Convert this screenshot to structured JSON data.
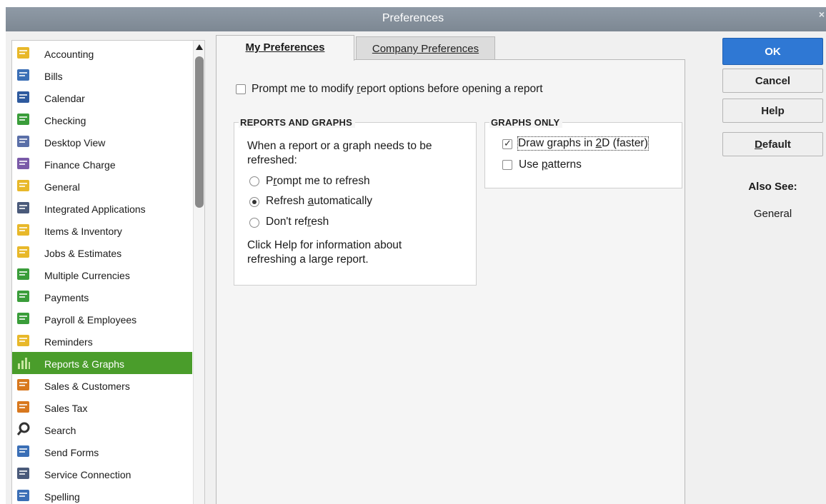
{
  "window": {
    "title": "Preferences",
    "close_glyph": "×"
  },
  "sidebar": {
    "items": [
      {
        "label": "Accounting",
        "icon": "accounting-icon"
      },
      {
        "label": "Bills",
        "icon": "bills-icon"
      },
      {
        "label": "Calendar",
        "icon": "calendar-icon"
      },
      {
        "label": "Checking",
        "icon": "checking-icon"
      },
      {
        "label": "Desktop View",
        "icon": "desktop-view-icon"
      },
      {
        "label": "Finance Charge",
        "icon": "finance-charge-icon"
      },
      {
        "label": "General",
        "icon": "general-icon"
      },
      {
        "label": "Integrated Applications",
        "icon": "integrated-applications-icon"
      },
      {
        "label": "Items & Inventory",
        "icon": "items-inventory-icon"
      },
      {
        "label": "Jobs & Estimates",
        "icon": "jobs-estimates-icon"
      },
      {
        "label": "Multiple Currencies",
        "icon": "multiple-currencies-icon"
      },
      {
        "label": "Payments",
        "icon": "payments-icon"
      },
      {
        "label": "Payroll & Employees",
        "icon": "payroll-employees-icon"
      },
      {
        "label": "Reminders",
        "icon": "reminders-icon"
      },
      {
        "label": "Reports & Graphs",
        "icon": "reports-graphs-icon",
        "selected": true
      },
      {
        "label": "Sales & Customers",
        "icon": "sales-customers-icon"
      },
      {
        "label": "Sales Tax",
        "icon": "sales-tax-icon"
      },
      {
        "label": "Search",
        "icon": "search-icon"
      },
      {
        "label": "Send Forms",
        "icon": "send-forms-icon"
      },
      {
        "label": "Service Connection",
        "icon": "service-connection-icon"
      },
      {
        "label": "Spelling",
        "icon": "spelling-icon"
      }
    ]
  },
  "tabs": {
    "my_preferences": "My Preferences",
    "company_preferences": "Company Preferences"
  },
  "prompt_modify": {
    "label_pre": "Prompt me to modify ",
    "label_u": "r",
    "label_post": "eport options before opening a report",
    "checked": false
  },
  "reports_graphs": {
    "title": "REPORTS AND GRAPHS",
    "desc_line1": "When a report or a graph needs to be",
    "desc_line2": "refreshed:",
    "options": {
      "prompt": {
        "pre": "P",
        "u": "r",
        "post": "ompt me to refresh",
        "checked": false
      },
      "auto": {
        "pre": "Refresh ",
        "u": "a",
        "post": "utomatically",
        "checked": true
      },
      "dont": {
        "pre": "Don't ref",
        "u": "r",
        "post": "esh",
        "checked": false
      }
    },
    "help_line1": "Click Help for information about",
    "help_line2": "refreshing a large report."
  },
  "graphs_only": {
    "title": "GRAPHS ONLY",
    "draw_2d": {
      "pre": "Draw graphs in ",
      "u": "2",
      "post": "D (faster)",
      "checked": true
    },
    "patterns": {
      "pre": "Use ",
      "u": "p",
      "post": "atterns",
      "checked": false
    }
  },
  "buttons": {
    "ok": "OK",
    "cancel": "Cancel",
    "help": "Help",
    "default_u": "D",
    "default_rest": "efault"
  },
  "also_see": {
    "heading": "Also See:",
    "link": "General"
  },
  "colors": {
    "selected": "#4a9d2b",
    "primary_button": "#2f78d4",
    "titlebar": "#8692a0"
  }
}
